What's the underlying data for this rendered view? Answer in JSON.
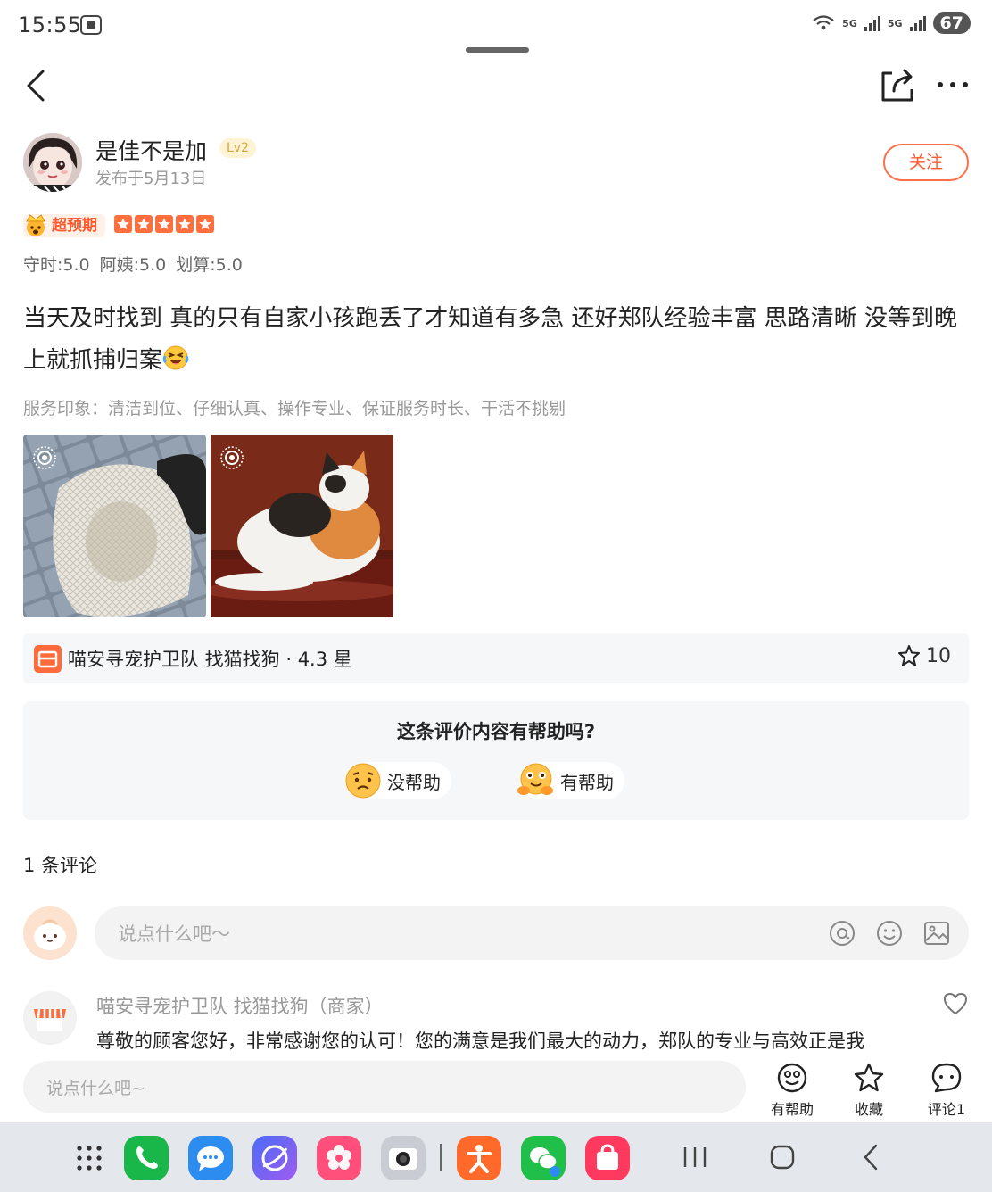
{
  "status_bar": {
    "time": "15:55",
    "battery": "67",
    "network_1": "5G",
    "network_2": "5G"
  },
  "author": {
    "name": "是佳不是加",
    "level": "Lv2",
    "date": "发布于5月13日",
    "follow_label": "关注"
  },
  "rating": {
    "tag": "超预期",
    "stars": 5,
    "scores": [
      "守时:5.0",
      "阿姨:5.0",
      "划算:5.0"
    ]
  },
  "review": {
    "text": "当天及时找到 真的只有自家小孩跑丢了才知道有多急 还好郑队经验丰富 思路清晰 没等到晚上就抓捕归案",
    "service_tags": "服务印象：清洁到位、仔细认真、操作专业、保证服务时长、干活不挑剔"
  },
  "shop": {
    "name": "喵安寻宠护卫队 找猫找狗 · 4.3 星",
    "favorites": "10"
  },
  "helpful": {
    "question": "这条评价内容有帮助吗?",
    "no_label": "没帮助",
    "yes_label": "有帮助"
  },
  "comments": {
    "count_label": "1 条评论",
    "input_placeholder": "说点什么吧～",
    "merchant_name": "喵安寻宠护卫队 找猫找狗（商家）",
    "merchant_text": "尊敬的顾客您好，非常感谢您的认可！您的满意是我们最大的动力，郑队的专业与高效正是我"
  },
  "bottom_bar": {
    "placeholder": "说点什么吧~",
    "helpful_label": "有帮助",
    "collect_label": "收藏",
    "comment_label": "评论1"
  },
  "colors": {
    "accent": "#ff5a2e",
    "star": "#ff6f3d",
    "panel": "#f6f7f8",
    "dock": "#e4e7ec"
  }
}
